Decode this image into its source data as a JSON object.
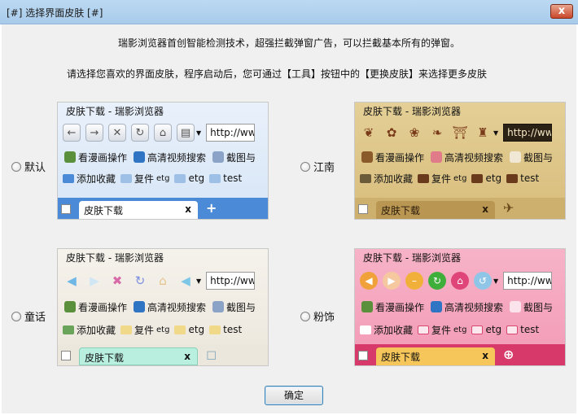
{
  "window": {
    "title": "[#] 选择界面皮肤 [#]",
    "close_label": "x"
  },
  "intro": {
    "line1": "瑞影浏览器首创智能检测技术，超强拦截弹窗广告，可以拦截基本所有的弹窗。",
    "line2": "请选择您喜欢的界面皮肤，程序启动后，您可通过【工具】按钮中的【更换皮肤】来选择更多皮肤"
  },
  "preview": {
    "title": "皮肤下载 - 瑞影浏览器",
    "address": "http://ww",
    "links": [
      "看漫画操作",
      "高清视频搜索",
      "截图与"
    ],
    "add_fav": "添加收藏",
    "favs": [
      {
        "label": "复件",
        "sub": "etg"
      },
      {
        "label": "etg",
        "sub": ""
      },
      {
        "label": "test",
        "sub": ""
      }
    ],
    "tab_label": "皮肤下载",
    "tab_close": "x",
    "tab_add": "+"
  },
  "skins": [
    {
      "label": "默认",
      "selected": false
    },
    {
      "label": "江南",
      "selected": false
    },
    {
      "label": "童话",
      "selected": false
    },
    {
      "label": "粉饰",
      "selected": false
    }
  ],
  "ok_label": "确定"
}
